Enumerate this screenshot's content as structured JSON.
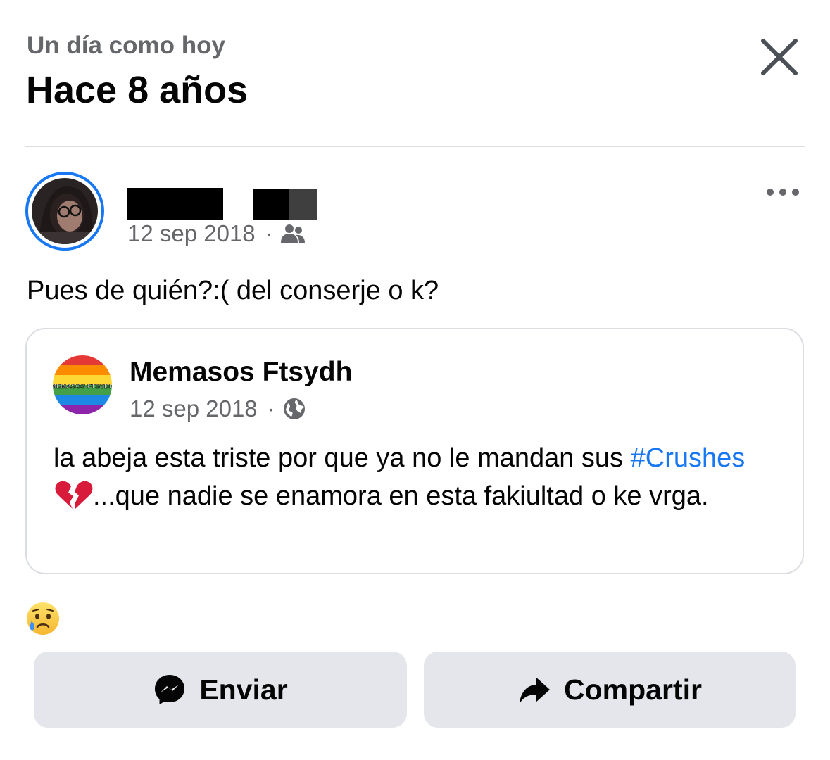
{
  "header": {
    "subtitle": "Un día como hoy",
    "title": "Hace 8 años",
    "close_icon": "close-icon"
  },
  "post": {
    "date": "12 sep 2018",
    "separator": "·",
    "audience_icon": "friends-icon",
    "more_icon": "more-options-icon",
    "text": "Pues de quién?:( del conserje o k?"
  },
  "shared": {
    "page_name": "Memasos Ftsydh",
    "avatar_text": "MEMASOS FTSYDH",
    "date": "12 sep 2018",
    "separator": "·",
    "audience_icon": "globe-icon",
    "text_before": "la abeja esta triste por que ya no le mandan sus",
    "hashtag": "#Crushes",
    "emoji_icon": "broken-heart-icon",
    "text_after": "...que nadie se enamora en esta fakiultad o ke vrga."
  },
  "reaction": {
    "icon": "crying-face-icon"
  },
  "actions": {
    "send_label": "Enviar",
    "send_icon": "messenger-icon",
    "share_label": "Compartir",
    "share_icon": "share-arrow-icon"
  },
  "colors": {
    "accent": "#1877f2",
    "secondary_text": "#65676b",
    "button_bg": "#e4e6eb",
    "divider": "#dadde1"
  }
}
